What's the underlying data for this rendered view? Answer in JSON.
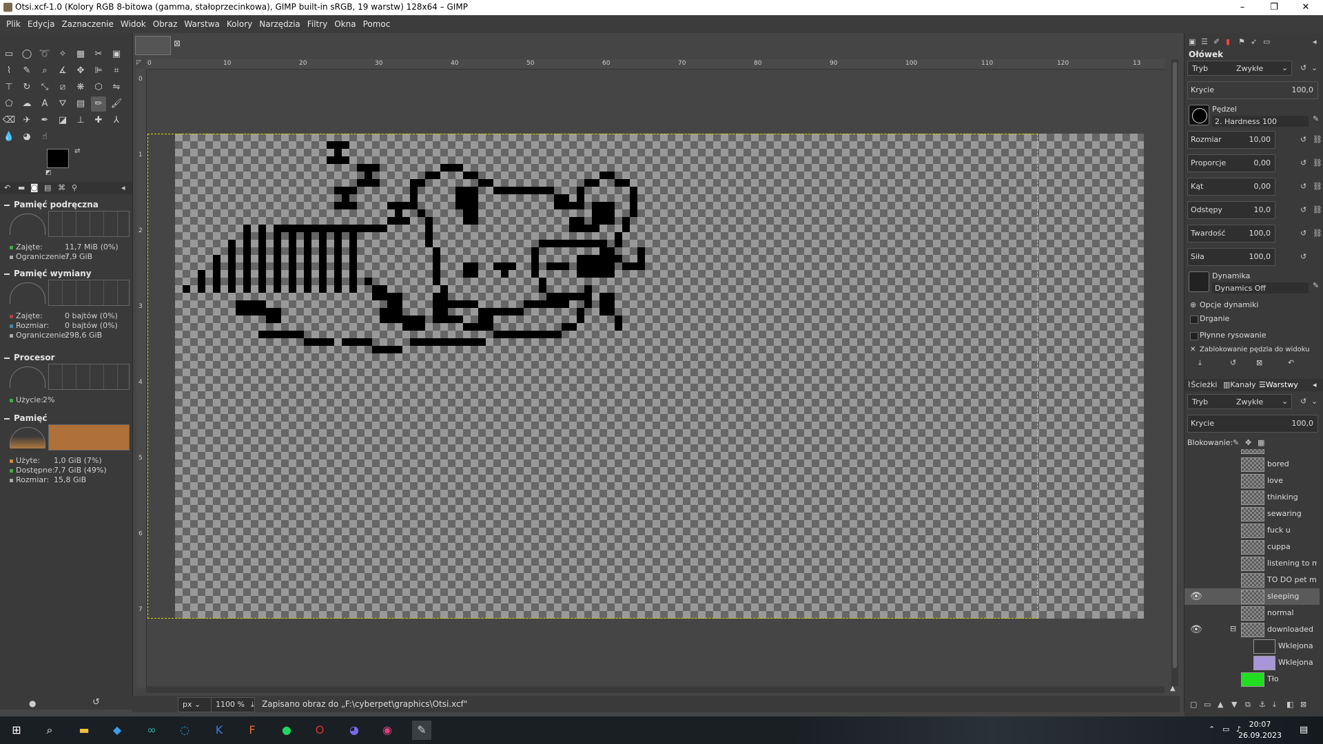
{
  "window": {
    "title": "Otsi.xcf-1.0 (Kolory RGB 8-bitowa (gamma, stałoprzecinkowa), GIMP built-in sRGB, 19 warstw) 128x64 – GIMP",
    "minimize": "–",
    "maximize": "❐",
    "close": "✕"
  },
  "menu": [
    "Plik",
    "Edycja",
    "Zaznaczenie",
    "Widok",
    "Obraz",
    "Warstwa",
    "Kolory",
    "Narzędzia",
    "Filtry",
    "Okna",
    "Pomoc"
  ],
  "dashboard": {
    "cache": {
      "title": "Pamięć podręczna",
      "rows": [
        {
          "label": "Zajęte:",
          "value": "11,7 MiB (0%)"
        },
        {
          "label": "Ograniczenie:",
          "value": "7,9 GiB"
        }
      ]
    },
    "swap": {
      "title": "Pamięć wymiany",
      "rows": [
        {
          "label": "Zajęte:",
          "value": "0 bajtów (0%)"
        },
        {
          "label": "Rozmiar:",
          "value": "0 bajtów (0%)"
        },
        {
          "label": "Ograniczenie:",
          "value": "298,6 GiB"
        }
      ]
    },
    "cpu": {
      "title": "Procesor",
      "rows": [
        {
          "label": "Użycie:",
          "value": "2%"
        }
      ]
    },
    "memory": {
      "title": "Pamięć",
      "rows": [
        {
          "label": "Użyte:",
          "value": "1,0 GiB (7%)"
        },
        {
          "label": "Dostępne:",
          "value": "7,7 GiB (49%)"
        },
        {
          "label": "Rozmiar:",
          "value": "15,8 GiB"
        }
      ]
    }
  },
  "ruler": {
    "h_ticks": [
      "0",
      "10",
      "20",
      "30",
      "40",
      "50",
      "60",
      "70",
      "80",
      "90",
      "100",
      "110",
      "120",
      "13"
    ],
    "v_ticks": [
      "0",
      "1",
      "2",
      "3",
      "4",
      "5",
      "6",
      "7"
    ]
  },
  "status": {
    "unit": "px",
    "zoom": "1100 %",
    "message": "Zapisano obraz do „F:\\cyberpet\\graphics\\Otsi.xcf\""
  },
  "tool_options": {
    "title": "Ołówek",
    "mode_label": "Tryb",
    "mode_value": "Zwykłe",
    "opacity": {
      "label": "Krycie",
      "value": "100,0"
    },
    "brush_label": "Pędzel",
    "brush_name": "2. Hardness 100",
    "size": {
      "label": "Rozmiar",
      "value": "10,00"
    },
    "aspect": {
      "label": "Proporcje",
      "value": "0,00"
    },
    "angle": {
      "label": "Kąt",
      "value": "0,00"
    },
    "spacing": {
      "label": "Odstępy",
      "value": "10,0"
    },
    "hardness": {
      "label": "Twardość",
      "value": "100,0"
    },
    "force": {
      "label": "Siła",
      "value": "100,0"
    },
    "dynamics_label": "Dynamika",
    "dynamics_value": "Dynamics Off",
    "dyn_options": "Opcje dynamiki",
    "jitter": "Drganie",
    "smooth": "Płynne rysowanie",
    "lock_brush": "Zablokowanie pędzla do widoku"
  },
  "layers_panel": {
    "tabs": [
      "Ścieżki",
      "Kanały",
      "Warstwy"
    ],
    "mode_label": "Tryb",
    "mode_value": "Zwykłe",
    "opacity_label": "Krycie",
    "opacity_value": "100,0",
    "lock_label": "Blokowanie:",
    "layers": [
      {
        "name": "bored"
      },
      {
        "name": "love"
      },
      {
        "name": "thinking"
      },
      {
        "name": "sewaring"
      },
      {
        "name": "fuck u"
      },
      {
        "name": "cuppa"
      },
      {
        "name": "listening to m"
      },
      {
        "name": "TO DO pet m"
      },
      {
        "name": "sleeping"
      },
      {
        "name": "normal"
      },
      {
        "name": "downloaded"
      },
      {
        "name": "Wklejona"
      },
      {
        "name": "Wklejona"
      },
      {
        "name": "Tło"
      }
    ]
  },
  "clock": {
    "time": "20:07",
    "date": "26.09.2023"
  },
  "colors": {
    "accent_green": "#22dd22",
    "fg_color": "#000000",
    "bg_color": "#ffffff"
  }
}
